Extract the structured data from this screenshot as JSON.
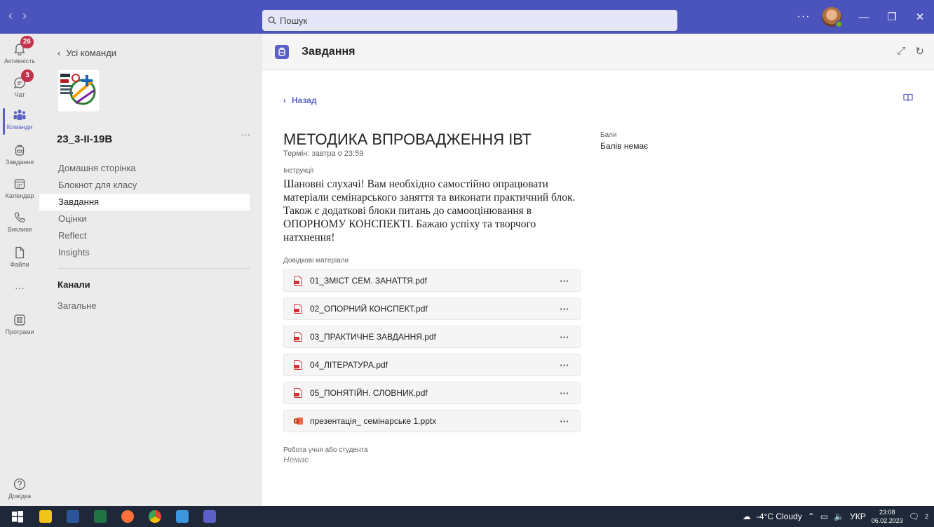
{
  "titlebar": {
    "search_placeholder": "Пошук",
    "more": "···"
  },
  "rail": {
    "items": [
      {
        "label": "Активність",
        "badge": "26"
      },
      {
        "label": "Чат",
        "badge": "3"
      },
      {
        "label": "Команди"
      },
      {
        "label": "Завдання"
      },
      {
        "label": "Календар"
      },
      {
        "label": "Виклики"
      },
      {
        "label": "Файли"
      },
      {
        "label": "···"
      },
      {
        "label": "Програми"
      },
      {
        "label": "Довідка"
      }
    ]
  },
  "team": {
    "back_label": "Усі команди",
    "name": "23_3-ІІ-19В",
    "more": "···",
    "tabs": [
      "Домашня сторінка",
      "Блокнот для класу",
      "Завдання",
      "Оцінки",
      "Reflect",
      "Insights"
    ],
    "channels_heading": "Канали",
    "channels": [
      "Загальне"
    ]
  },
  "main": {
    "app_title": "Завдання",
    "back_label": "Назад",
    "assignment": {
      "title": "МЕТОДИКА ВПРОВАДЖЕННЯ ІВТ",
      "deadline": "Термін: завтра о 23:59",
      "points_label": "Бали",
      "points_value": "Балів немає",
      "instructions_label": "Інструкції",
      "instructions": "Шановні слухачі! Вам необхідно самостійно опрацювати матеріали семінарського заняття та виконати практичний блок. Також є додаткові блоки питань до самооцінювання в ОПОРНОМУ КОНСПЕКТІ. Бажаю успіху та творчого натхнення!",
      "references_label": "Довідкові матеріали",
      "attachments": [
        {
          "name": "01_ЗМІСТ СЕМ. ЗАНАТТЯ.pdf",
          "type": "pdf"
        },
        {
          "name": "02_ОПОРНИЙ КОНСПЕКТ.pdf",
          "type": "pdf"
        },
        {
          "name": "03_ПРАКТИЧНЕ ЗАВДАННЯ.pdf",
          "type": "pdf"
        },
        {
          "name": "04_ЛІТЕРАТУРА.pdf",
          "type": "pdf"
        },
        {
          "name": "05_ПОНЯТІЙН. СЛОВНИК.pdf",
          "type": "pdf"
        },
        {
          "name": "презентація_ семінарське 1.pptx",
          "type": "pptx"
        }
      ],
      "attachment_more": "···",
      "student_work_label": "Робота учня або студента",
      "student_work_value": "Немає"
    }
  },
  "taskbar": {
    "weather": "-4°C Cloudy",
    "language": "УКР",
    "time": "23:08",
    "date": "06.02.2023",
    "notifications": "2"
  },
  "colors": {
    "accent": "#5b5fc7",
    "titlebar": "#4b53bc",
    "badge": "#c4314b",
    "pdf": "#d13438",
    "pptx": "#c43e1c"
  }
}
